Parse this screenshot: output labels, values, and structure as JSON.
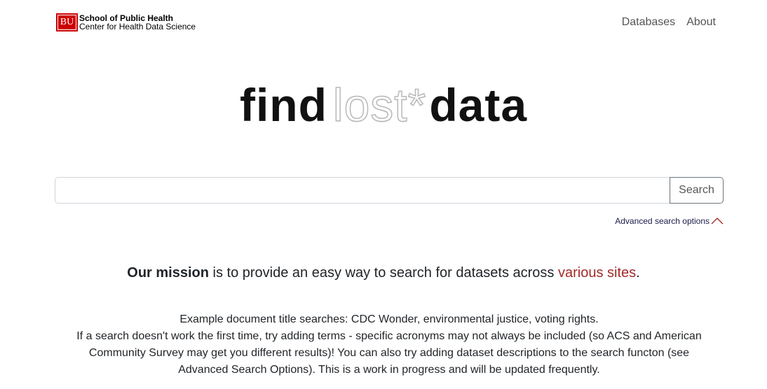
{
  "header": {
    "logo_text": "BU",
    "brand_line1": "School of Public Health",
    "brand_line2": "Center for Health Data Science",
    "nav": [
      {
        "label": "Databases"
      },
      {
        "label": "About"
      }
    ]
  },
  "hero": {
    "word1": "find",
    "word2": "lost*",
    "word3": "data"
  },
  "search": {
    "value": "",
    "placeholder": "",
    "button_label": "Search"
  },
  "advanced": {
    "label": "Advanced search options",
    "icon": "chevron-up-icon",
    "icon_color": "#a52a2a"
  },
  "mission": {
    "bold": "Our mission",
    "text": " is to provide an easy way to search for datasets across ",
    "link": "various sites",
    "end": ".",
    "link_color": "#a52a2a"
  },
  "examples": {
    "line1": "Example document title searches: CDC Wonder, environmental justice, voting rights.",
    "line2": "If a search doesn't work the first time, try adding terms - specific acronyms may not always be included (so ACS and American Community Survey may get you different results)! You can also try adding dataset descriptions to the search functon (see Advanced Search Options). This is a work in progress and will be updated frequently."
  }
}
